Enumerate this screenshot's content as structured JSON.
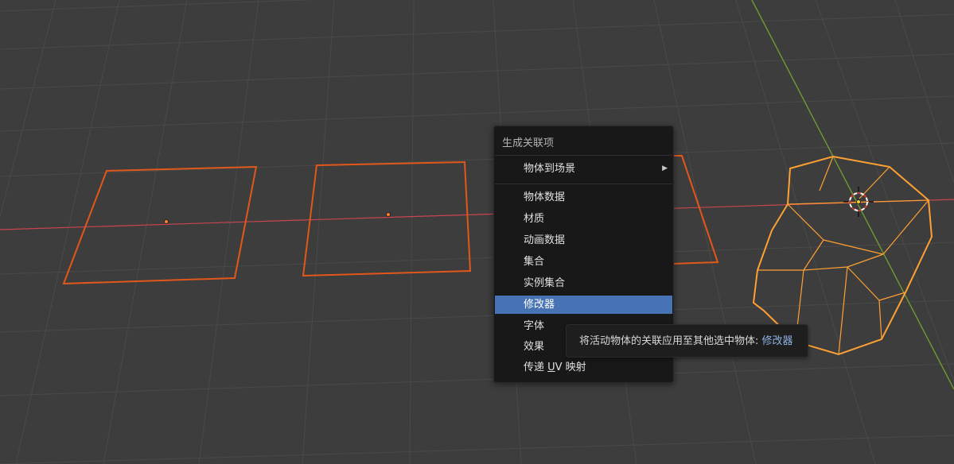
{
  "menu": {
    "title": "生成关联项",
    "submenu_item": {
      "label": "物体到场景",
      "arrow": "▶"
    },
    "items": [
      {
        "label": "物体数据"
      },
      {
        "label": "材质"
      },
      {
        "label": "动画数据"
      },
      {
        "label": "集合"
      },
      {
        "label": "实例集合"
      },
      {
        "label": "修改器",
        "active": true
      },
      {
        "label": "字体"
      },
      {
        "label": "效果"
      }
    ],
    "transfer_uv": {
      "prefix": "传递 ",
      "underlined": "U",
      "suffix": "V 映射"
    }
  },
  "tooltip": {
    "text": "将活动物体的关联应用至其他选中物体: ",
    "highlight": "修改器"
  },
  "colors": {
    "viewport_bg": "#3d3d3d",
    "grid_line": "#4a4a4a",
    "x_axis": "#c9454f",
    "y_axis": "#6f9a32",
    "selected_outline": "#e2571a",
    "active_outline": "#ffa033",
    "menu_highlight": "#4772b3"
  }
}
